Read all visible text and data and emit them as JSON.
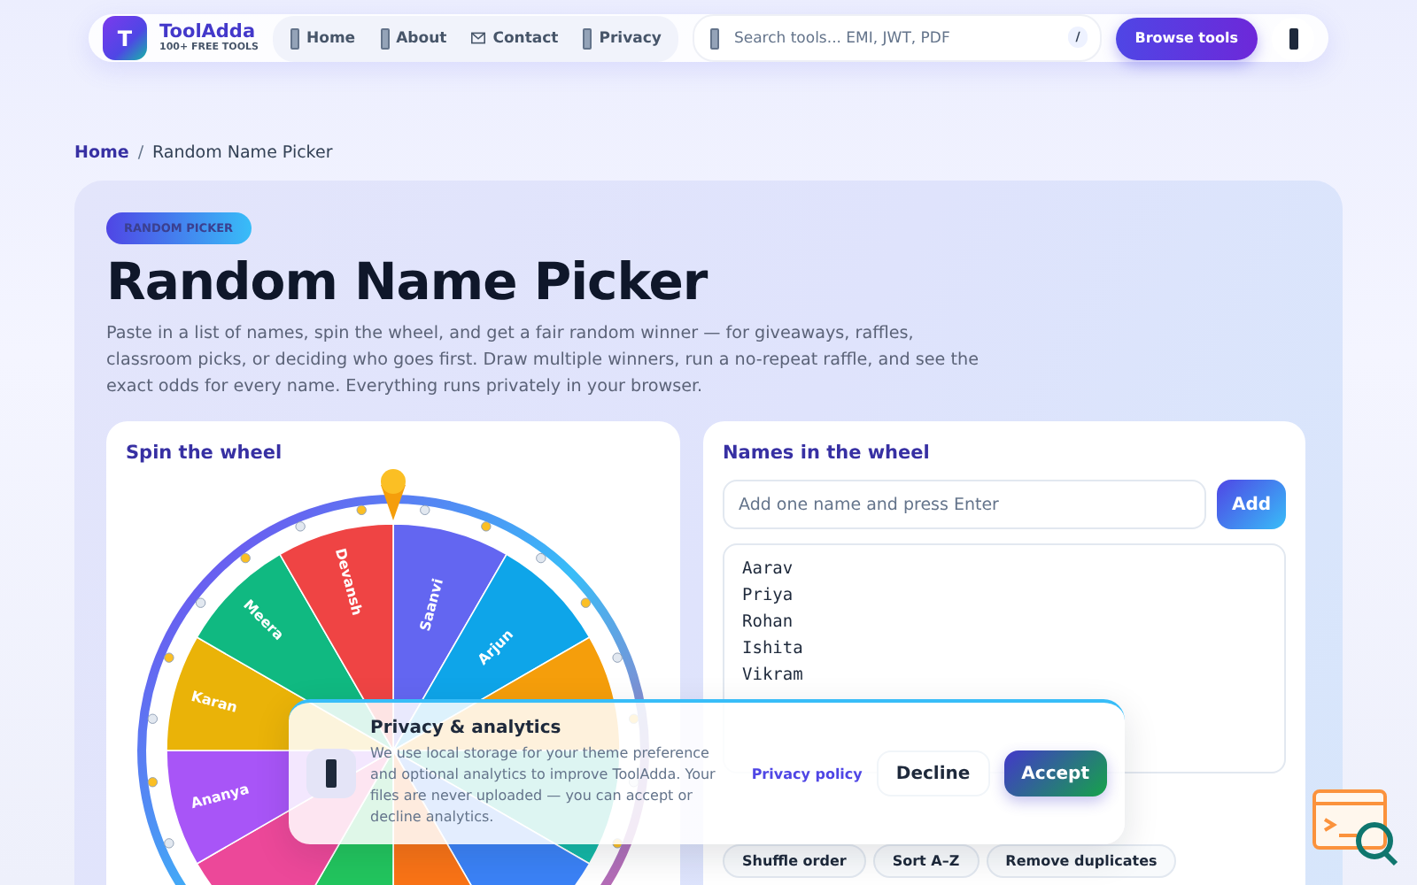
{
  "header": {
    "logo": {
      "letter": "T",
      "name": "ToolAdda",
      "tagline": "100+ FREE TOOLS"
    },
    "nav": [
      {
        "label": "Home",
        "kind": "bar"
      },
      {
        "label": "About",
        "kind": "bar"
      },
      {
        "label": "Contact",
        "kind": "envelope"
      },
      {
        "label": "Privacy",
        "kind": "bar"
      }
    ],
    "search": {
      "placeholder": "Search tools... EMI, JWT, PDF",
      "shortcut": "/"
    },
    "cta": "Browse tools"
  },
  "breadcrumb": {
    "items": [
      {
        "label": "Home",
        "current": false
      },
      {
        "label": "Random Name Picker",
        "current": true
      }
    ],
    "separator": "/"
  },
  "hero": {
    "badge": "RANDOM PICKER",
    "title": "Random Name Picker",
    "description": "Paste in a list of names, spin the wheel, and get a fair random winner — for giveaways, raffles, classroom picks, or deciding who goes first. Draw multiple winners, run a no-repeat raffle, and see the exact odds for every name. Everything runs privately in your browser."
  },
  "wheel_card": {
    "title": "Spin the wheel",
    "segments": [
      {
        "label": "Saanvi",
        "color": "#6366f1"
      },
      {
        "label": "Arjun",
        "color": "#0ea5e9"
      },
      {
        "color": "#f59e0b"
      },
      {
        "color": "#14b8a6"
      },
      {
        "color": "#3b82f6"
      },
      {
        "color": "#f97316"
      },
      {
        "color": "#22c55e"
      },
      {
        "color": "#ec4899"
      },
      {
        "label": "Ananya",
        "color": "#a855f7"
      },
      {
        "label": "Karan",
        "color": "#eab308"
      },
      {
        "label": "Meera",
        "color": "#10b981"
      },
      {
        "label": "Devansh",
        "color": "#ef4444"
      }
    ]
  },
  "names_card": {
    "title": "Names in the wheel",
    "input_placeholder": "Add one name and press Enter",
    "add_button": "Add",
    "names": [
      "Aarav",
      "Priya",
      "Rohan",
      "Ishita",
      "Vikram"
    ],
    "actions": [
      "Shuffle order",
      "Sort A–Z",
      "Remove duplicates"
    ]
  },
  "consent": {
    "title": "Privacy & analytics",
    "text": "We use local storage for your theme preference and optional analytics to improve ToolAdda. Your files are never uploaded — you can accept or decline analytics.",
    "link": "Privacy policy",
    "buttons": [
      {
        "label": "Decline",
        "kind": "secondary"
      },
      {
        "label": "Accept",
        "kind": "primary"
      }
    ]
  }
}
